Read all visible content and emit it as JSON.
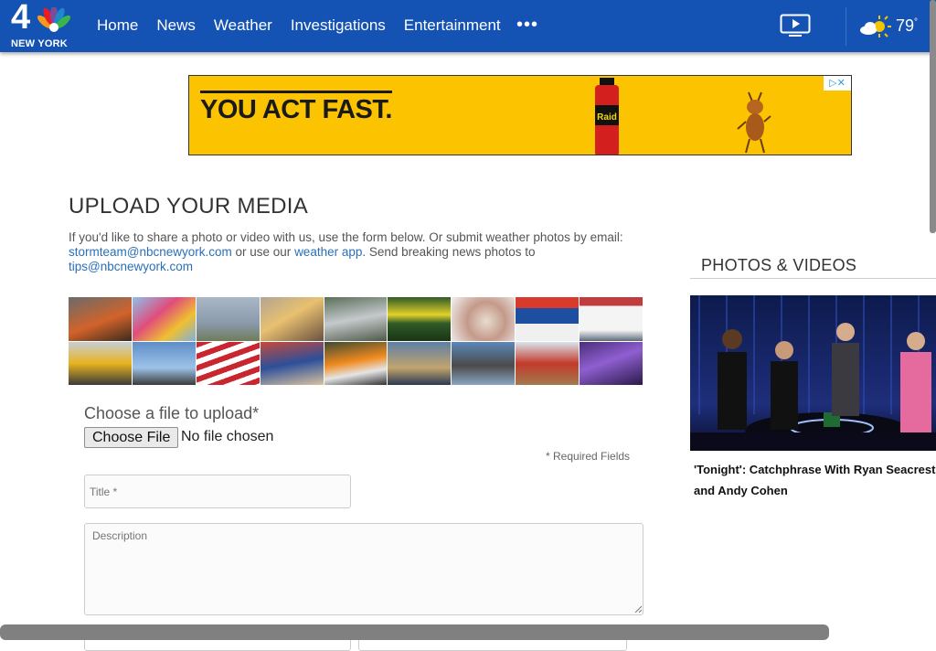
{
  "header": {
    "logo_number": "4",
    "logo_city": "NEW YORK",
    "nav": [
      "Home",
      "News",
      "Weather",
      "Investigations",
      "Entertainment"
    ],
    "more": "•••",
    "temperature": "79",
    "temp_unit": "°",
    "icons": {
      "video": "tv-play-icon",
      "weather": "partly-sunny-icon",
      "more": "more-dots-icon"
    }
  },
  "ad": {
    "headline": "YOU ACT FAST.",
    "can_brand": "Raid"
  },
  "main": {
    "title": "UPLOAD YOUR MEDIA",
    "intro_1": "If you'd like to share a photo or video with us, use the form below. Or submit weather photos by email: ",
    "email_storm": "stormteam@nbcnewyork.com",
    "intro_2": " or use our ",
    "weather_app": "weather app",
    "intro_3": ". Send breaking news photos to ",
    "email_tips": "tips@nbcnewyork.com",
    "upload_label": "Choose a file to upload*",
    "choose_button": "Choose File",
    "no_file": "No file chosen",
    "required_note": "*  Required Fields",
    "title_placeholder": "Title *",
    "description_placeholder": "Description"
  },
  "sidebar": {
    "title": "PHOTOS & VIDEOS",
    "caption_1": "'Tonight': Catchphrase With Ryan Seacrest",
    "caption_2": "and Andy Cohen"
  },
  "colors": {
    "brand_blue": "#1452b4",
    "ad_yellow": "#fcc400",
    "link": "#2a6fb7"
  }
}
